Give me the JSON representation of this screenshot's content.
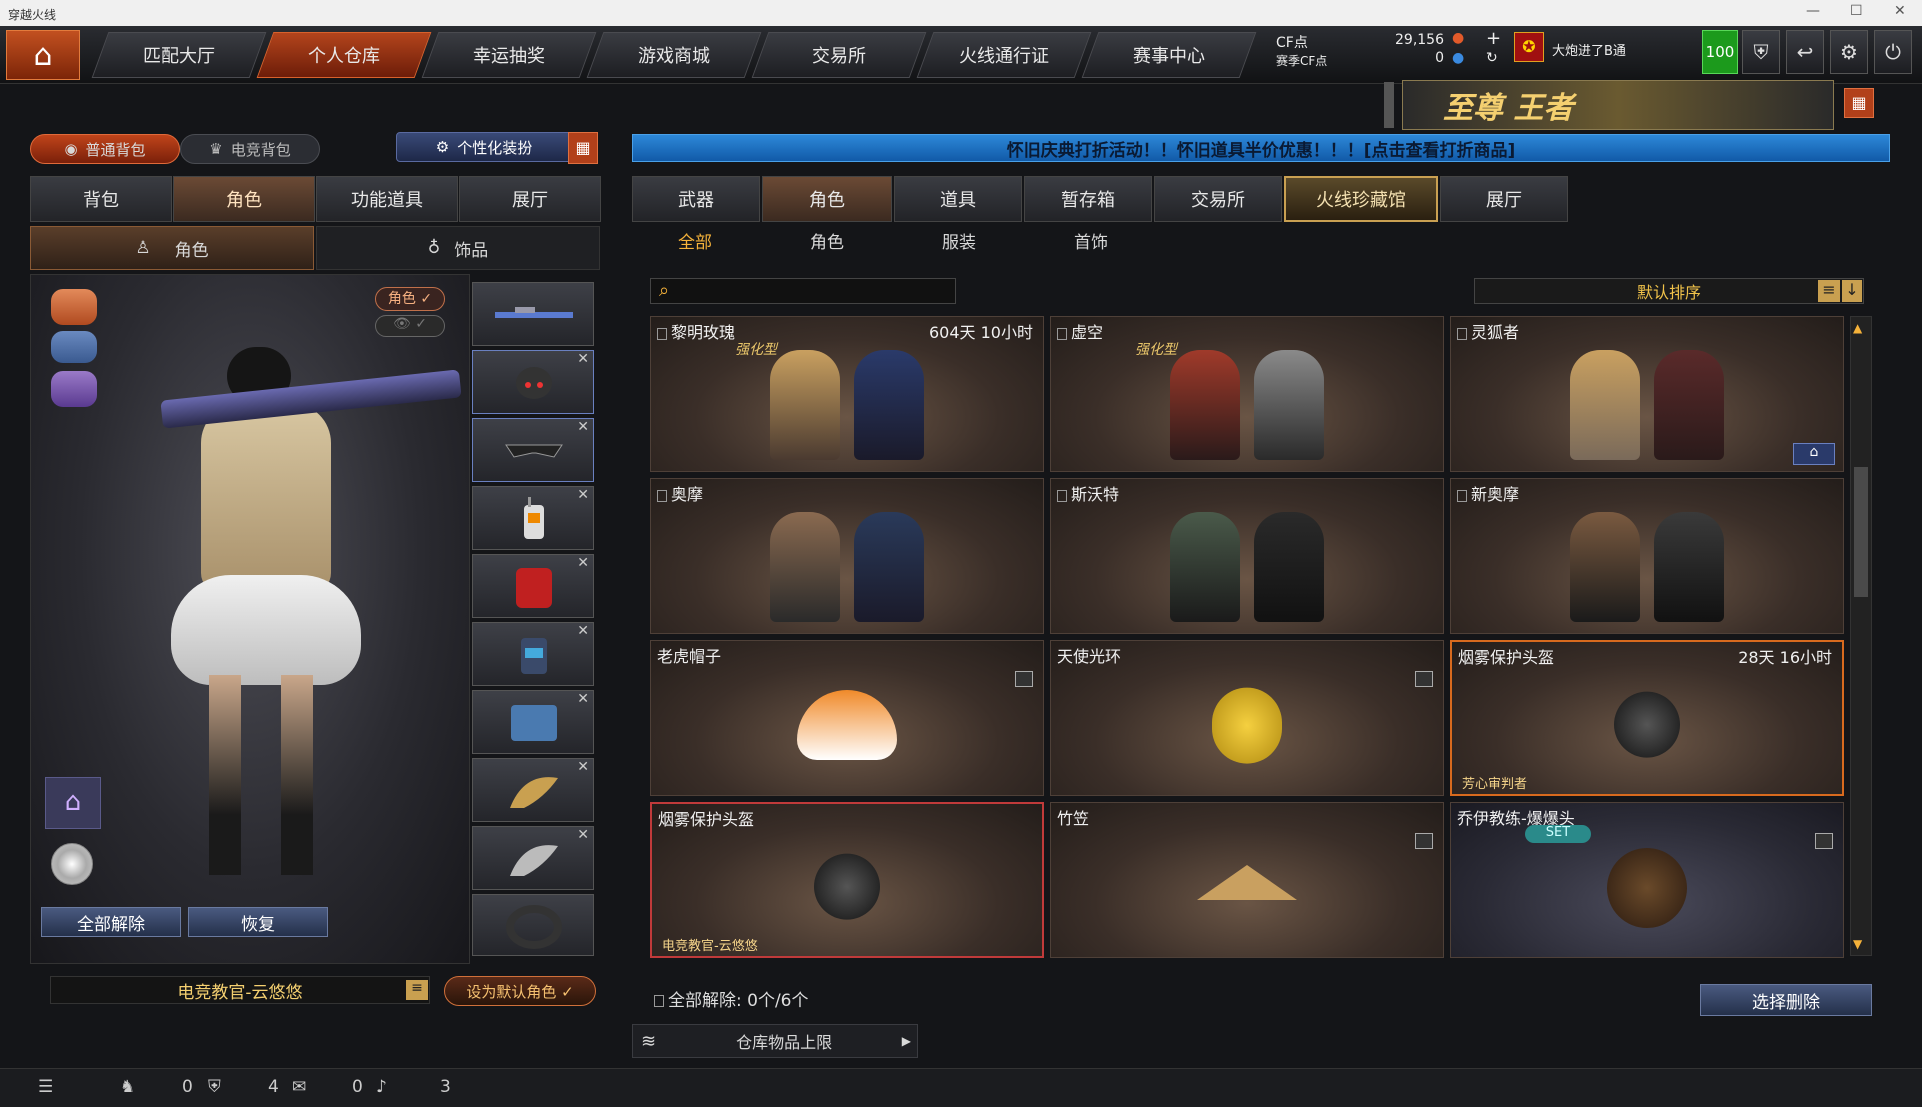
{
  "window": {
    "title": "穿越火线"
  },
  "nav": {
    "tabs": [
      "匹配大厅",
      "个人仓库",
      "幸运抽奖",
      "游戏商城",
      "交易所",
      "火线通行证",
      "赛事中心"
    ],
    "active": 1
  },
  "currency": {
    "cf_label": "CF点",
    "cf_value": "29,156",
    "season_label": "赛季CF点",
    "season_value": "0"
  },
  "user": {
    "name": "大炮进了B通",
    "level": "100"
  },
  "promo": {
    "banner_text": "至尊 王者"
  },
  "left": {
    "bag_tabs": [
      "普通背包",
      "电竞背包"
    ],
    "custom_label": "个性化装扮",
    "tabs": [
      "背包",
      "角色",
      "功能道具",
      "展厅"
    ],
    "active_tab": 1,
    "subtabs": [
      "角色",
      "饰品"
    ],
    "active_subtab": 0,
    "role_toggle": "角色 ✓",
    "btn_unequip_all": "全部解除",
    "btn_restore": "恢复",
    "character_name": "电竞教官-云悠悠",
    "btn_set_default": "设为默认角色 ✓"
  },
  "right": {
    "notice": "怀旧庆典打折活动！！怀旧道具半价优惠！！！[点击查看打折商品]",
    "tabs": [
      "武器",
      "角色",
      "道具",
      "暂存箱",
      "交易所",
      "火线珍藏馆",
      "展厅"
    ],
    "active_tab": 1,
    "gold_tab": 5,
    "subtabs": [
      "全部",
      "角色",
      "服装",
      "首饰"
    ],
    "active_subtab": 0,
    "sort_label": "默认排序",
    "cards": [
      {
        "name": "黎明玫瑰",
        "time": "604天 10小时",
        "enhanced": "强化型",
        "owner": ""
      },
      {
        "name": "虚空",
        "time": "",
        "enhanced": "强化型",
        "owner": ""
      },
      {
        "name": "灵狐者",
        "time": "",
        "enhanced": "",
        "owner": ""
      },
      {
        "name": "奥摩",
        "time": "",
        "enhanced": "",
        "owner": ""
      },
      {
        "name": "斯沃特",
        "time": "",
        "enhanced": "",
        "owner": ""
      },
      {
        "name": "新奥摩",
        "time": "",
        "enhanced": "",
        "owner": ""
      },
      {
        "name": "老虎帽子",
        "time": "",
        "enhanced": "",
        "owner": ""
      },
      {
        "name": "天使光环",
        "time": "",
        "enhanced": "",
        "owner": ""
      },
      {
        "name": "烟雾保护头盔",
        "time": "28天 16小时",
        "enhanced": "",
        "owner": "芳心审判者"
      },
      {
        "name": "烟雾保护头盔",
        "time": "",
        "enhanced": "",
        "owner": "电竞教官-云悠悠"
      },
      {
        "name": "竹笠",
        "time": "",
        "enhanced": "",
        "owner": ""
      },
      {
        "name": "乔伊教练-爆爆头",
        "time": "",
        "enhanced": "SET",
        "owner": ""
      }
    ],
    "footer_unequip": "全部解除: 0个/6个",
    "btn_select_delete": "选择删除",
    "storage_limit": "仓库物品上限"
  },
  "status": {
    "count1": "0",
    "count2": "4",
    "count3": "0",
    "count4": "3"
  },
  "colors": {
    "accent": "#c25020",
    "gold": "#f5b23a",
    "blue": "#2d88d8"
  }
}
